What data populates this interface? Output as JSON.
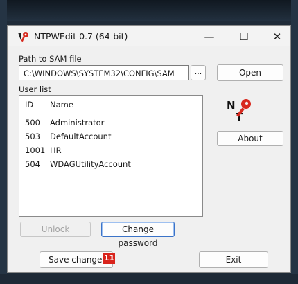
{
  "window": {
    "title": "NTPWEdit 0.7 (64-bit)",
    "controls": {
      "minimize": "—",
      "maximize": "☐",
      "close": "✕"
    }
  },
  "sam": {
    "label": "Path to SAM file",
    "path": "C:\\WINDOWS\\SYSTEM32\\CONFIG\\SAM",
    "browse_label": "...",
    "open_label": "Open"
  },
  "userlist": {
    "label": "User list",
    "columns": {
      "id": "ID",
      "name": "Name"
    },
    "rows": [
      {
        "id": "500",
        "name": "Administrator"
      },
      {
        "id": "503",
        "name": "DefaultAccount"
      },
      {
        "id": "1001",
        "name": "HR"
      },
      {
        "id": "504",
        "name": "WDAGUtilityAccount"
      }
    ]
  },
  "actions": {
    "unlock_label": "Unlock",
    "change_password_label": "Change password",
    "about_label": "About",
    "save_label": "Save changes",
    "exit_label": "Exit"
  },
  "annotation": {
    "step": "11",
    "color": "#d9241c"
  }
}
